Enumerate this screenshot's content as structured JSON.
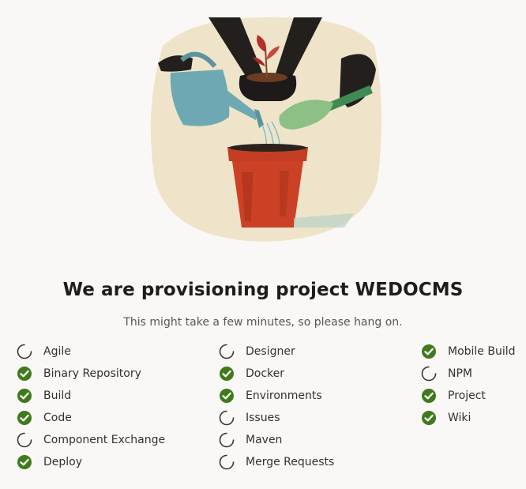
{
  "page": {
    "title": "We are provisioning project WEDOCMS",
    "subtitle": "This might take a few minutes, so please hang on."
  },
  "colors": {
    "background": "#f9f8f6",
    "done": "#3f7a1c",
    "pending": "#3a3733"
  },
  "illustration": {
    "icon": "gardening-illustration"
  },
  "services": {
    "col1": [
      {
        "label": "Agile",
        "status": "pending"
      },
      {
        "label": "Binary Repository",
        "status": "done"
      },
      {
        "label": "Build",
        "status": "done"
      },
      {
        "label": "Code",
        "status": "done"
      },
      {
        "label": "Component Exchange",
        "status": "pending"
      },
      {
        "label": "Deploy",
        "status": "done"
      }
    ],
    "col2": [
      {
        "label": "Designer",
        "status": "pending"
      },
      {
        "label": "Docker",
        "status": "done"
      },
      {
        "label": "Environments",
        "status": "done"
      },
      {
        "label": "Issues",
        "status": "pending"
      },
      {
        "label": "Maven",
        "status": "pending"
      },
      {
        "label": "Merge Requests",
        "status": "pending"
      }
    ],
    "col3": [
      {
        "label": "Mobile Build",
        "status": "done"
      },
      {
        "label": "NPM",
        "status": "pending"
      },
      {
        "label": "Project",
        "status": "done"
      },
      {
        "label": "Wiki",
        "status": "done"
      }
    ]
  }
}
